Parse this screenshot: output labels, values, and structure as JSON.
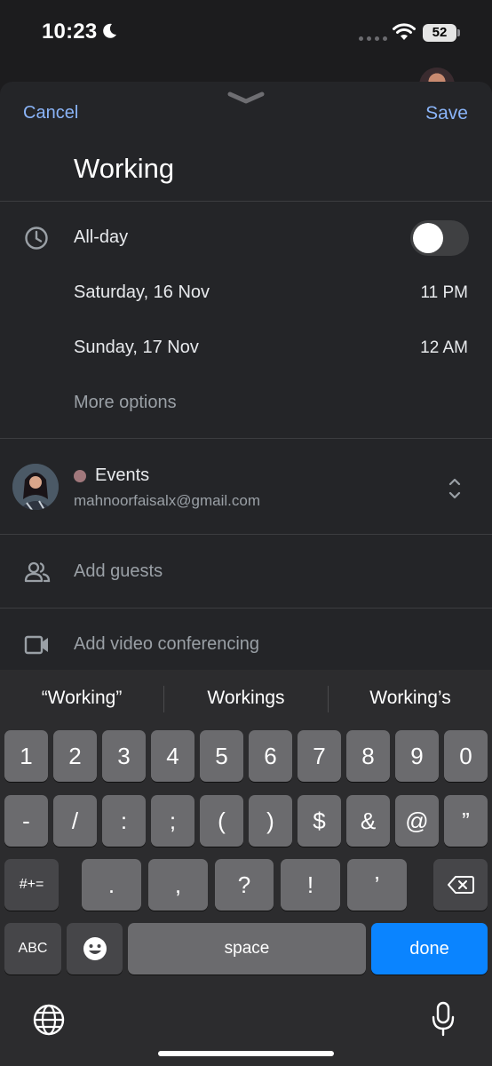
{
  "status": {
    "time": "10:23",
    "battery": "52"
  },
  "sheet": {
    "cancel": "Cancel",
    "save": "Save",
    "title": "Working"
  },
  "datetime": {
    "allday_label": "All-day",
    "allday_on": false,
    "start_date": "Saturday, 16 Nov",
    "start_time": "11 PM",
    "end_date": "Sunday, 17 Nov",
    "end_time": "12 AM",
    "more_options": "More options"
  },
  "calendar": {
    "name": "Events",
    "email": "mahnoorfaisalx@gmail.com",
    "color": "#a1787c"
  },
  "guests": {
    "label": "Add guests"
  },
  "video": {
    "label": "Add video conferencing"
  },
  "keyboard": {
    "suggestions": [
      "“Working”",
      "Workings",
      "Working’s"
    ],
    "row1": [
      "1",
      "2",
      "3",
      "4",
      "5",
      "6",
      "7",
      "8",
      "9",
      "0"
    ],
    "row2": [
      "-",
      "/",
      ":",
      ";",
      "(",
      ")",
      "$",
      "&",
      "@",
      "”"
    ],
    "row3_left": "#+=",
    "row3": [
      ".",
      ",",
      "?",
      "!",
      "’"
    ],
    "abc": "ABC",
    "space": "space",
    "done": "done"
  },
  "accent": "#8ab4f8",
  "done_color": "#0a84ff"
}
